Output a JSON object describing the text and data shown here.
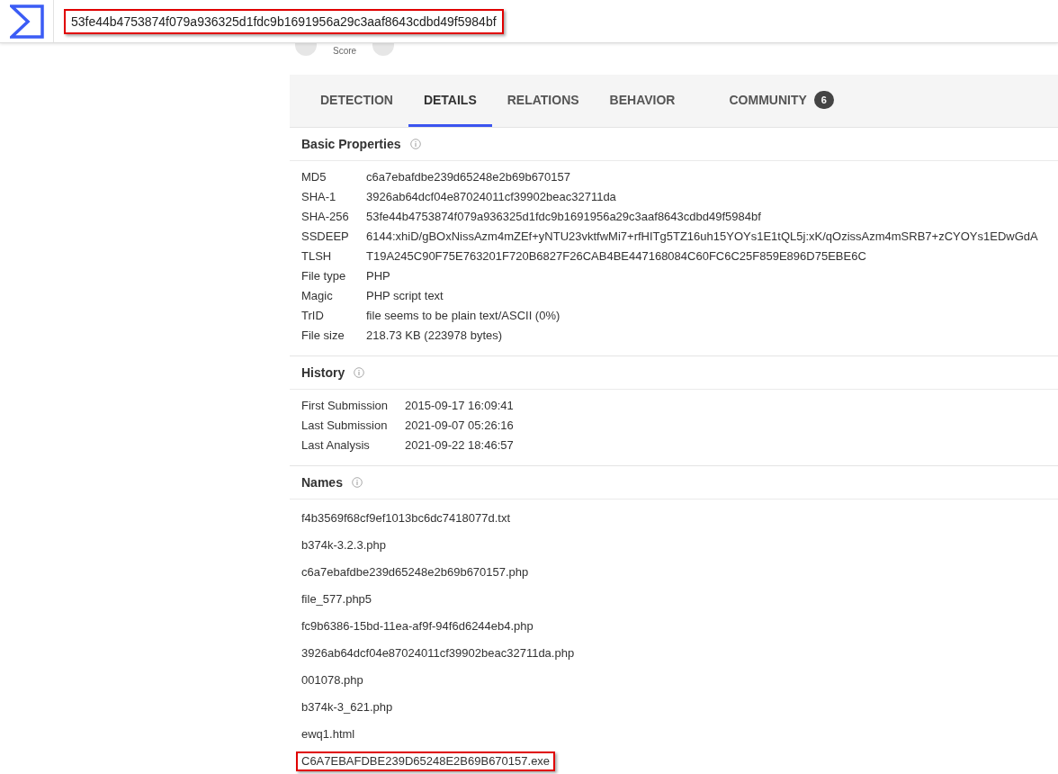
{
  "search": {
    "value": "53fe44b4753874f079a936325d1fdc9b1691956a29c3aaf8643cdbd49f5984bf",
    "highlighted": true
  },
  "score": {
    "label": "Score"
  },
  "tabs": [
    {
      "label": "DETECTION",
      "selected": false
    },
    {
      "label": "DETAILS",
      "selected": true
    },
    {
      "label": "RELATIONS",
      "selected": false
    },
    {
      "label": "BEHAVIOR",
      "selected": false
    },
    {
      "label": "COMMUNITY",
      "selected": false,
      "badge": "6"
    }
  ],
  "basic_properties": {
    "title": "Basic Properties",
    "rows": [
      {
        "label": "MD5",
        "value": "c6a7ebafdbe239d65248e2b69b670157"
      },
      {
        "label": "SHA-1",
        "value": "3926ab64dcf04e87024011cf39902beac32711da"
      },
      {
        "label": "SHA-256",
        "value": "53fe44b4753874f079a936325d1fdc9b1691956a29c3aaf8643cdbd49f5984bf"
      },
      {
        "label": "SSDEEP",
        "value": "6144:xhiD/gBOxNissAzm4mZEf+yNTU23vktfwMi7+rfHITg5TZ16uh15YOYs1E1tQL5j:xK/qOzissAzm4mSRB7+zCYOYs1EDwGdA"
      },
      {
        "label": "TLSH",
        "value": "T19A245C90F75E763201F720B6827F26CAB4BE447168084C60FC6C25F859E896D75EBE6C"
      },
      {
        "label": "File type",
        "value": "PHP"
      },
      {
        "label": "Magic",
        "value": "PHP script text"
      },
      {
        "label": "TrID",
        "value": "file seems to be plain text/ASCII (0%)"
      },
      {
        "label": "File size",
        "value": "218.73 KB (223978 bytes)"
      }
    ]
  },
  "history": {
    "title": "History",
    "rows": [
      {
        "label": "First Submission",
        "value": "2015-09-17 16:09:41"
      },
      {
        "label": "Last Submission",
        "value": "2021-09-07 05:26:16"
      },
      {
        "label": "Last Analysis",
        "value": "2021-09-22 18:46:57"
      }
    ]
  },
  "names": {
    "title": "Names",
    "items": [
      {
        "text": "f4b3569f68cf9ef1013bc6dc7418077d.txt",
        "highlighted": false
      },
      {
        "text": "b374k-3.2.3.php",
        "highlighted": false
      },
      {
        "text": "c6a7ebafdbe239d65248e2b69b670157.php",
        "highlighted": false
      },
      {
        "text": "file_577.php5",
        "highlighted": false
      },
      {
        "text": "fc9b6386-15bd-11ea-af9f-94f6d6244eb4.php",
        "highlighted": false
      },
      {
        "text": "3926ab64dcf04e87024011cf39902beac32711da.php",
        "highlighted": false
      },
      {
        "text": "001078.php",
        "highlighted": false
      },
      {
        "text": "b374k-3_621.php",
        "highlighted": false
      },
      {
        "text": "ewq1.html",
        "highlighted": false
      },
      {
        "text": "C6A7EBAFDBE239D65248E2B69B670157.exe",
        "highlighted": true
      }
    ]
  }
}
